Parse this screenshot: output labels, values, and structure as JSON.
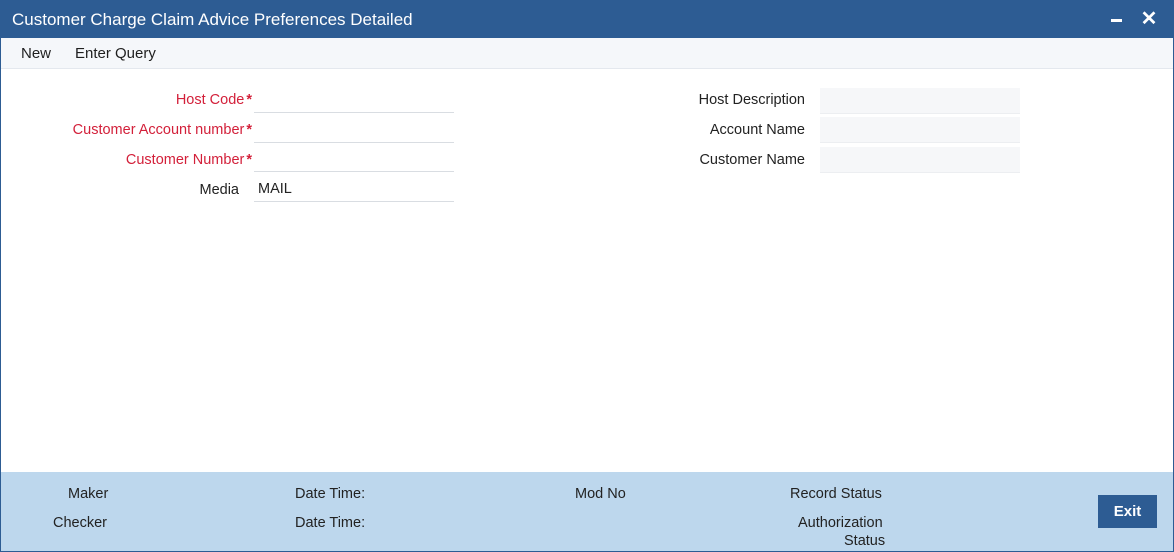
{
  "window": {
    "title": "Customer Charge Claim Advice Preferences Detailed",
    "minimize_glyph": "",
    "close_glyph": "✕"
  },
  "menu": {
    "items": [
      {
        "label": "New"
      },
      {
        "label": "Enter Query"
      }
    ]
  },
  "form": {
    "host_code": {
      "label": "Host Code",
      "required": "*",
      "value": ""
    },
    "customer_account_number": {
      "label": "Customer Account number",
      "required": "*",
      "value": ""
    },
    "customer_number": {
      "label": "Customer Number",
      "required": "*",
      "value": ""
    },
    "media": {
      "label": "Media",
      "value": "MAIL"
    },
    "host_description": {
      "label": "Host Description",
      "value": ""
    },
    "account_name": {
      "label": "Account Name",
      "value": ""
    },
    "customer_name": {
      "label": "Customer Name",
      "value": ""
    }
  },
  "footer": {
    "maker": "Maker",
    "checker": "Checker",
    "date_time_1": "Date Time:",
    "date_time_2": "Date Time:",
    "mod_no": "Mod No",
    "record_status": "Record Status",
    "authorization_status_line1": "Authorization",
    "authorization_status_line2": "Status",
    "exit_label": "Exit"
  },
  "colors": {
    "titlebar": "#2d5c93",
    "required_label": "#d3203a",
    "footer_bg": "#bdd7ed"
  }
}
